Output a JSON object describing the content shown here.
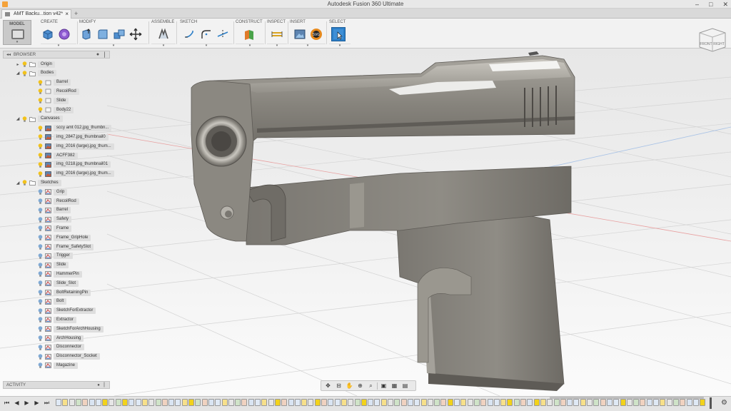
{
  "window": {
    "title": "Autodesk Fusion 360 Ultimate"
  },
  "tab": {
    "label": "AMT Backu...tion v42*"
  },
  "workspace": {
    "label": "MODEL"
  },
  "toolbar_groups": [
    {
      "label": "CREATE"
    },
    {
      "label": "MODIFY"
    },
    {
      "label": "ASSEMBLE"
    },
    {
      "label": "SKETCH"
    },
    {
      "label": "CONSTRUCT"
    },
    {
      "label": "INSPECT"
    },
    {
      "label": "INSERT"
    },
    {
      "label": "SELECT"
    }
  ],
  "viewcube": {
    "front": "FRONT",
    "right": "RIGHT"
  },
  "browser": {
    "title": "BROWSER",
    "items": [
      {
        "label": "Origin",
        "level": 1,
        "twisty": "▸",
        "kind": "folder"
      },
      {
        "label": "Bodies",
        "level": 1,
        "twisty": "◢",
        "kind": "folder"
      },
      {
        "label": "Barrel",
        "level": 2,
        "twisty": "",
        "kind": "body"
      },
      {
        "label": "RecoilRod",
        "level": 2,
        "twisty": "",
        "kind": "body"
      },
      {
        "label": "Slide",
        "level": 2,
        "twisty": "",
        "kind": "body"
      },
      {
        "label": "Body22",
        "level": 2,
        "twisty": "",
        "kind": "body"
      },
      {
        "label": "Canvases",
        "level": 1,
        "twisty": "◢",
        "kind": "folder"
      },
      {
        "label": "sccy amt 012.jpg_thumbn...",
        "level": 2,
        "twisty": "",
        "kind": "canvas"
      },
      {
        "label": "img_2847.jpg_thumbnail0",
        "level": 2,
        "twisty": "",
        "kind": "canvas"
      },
      {
        "label": "img_2016 (large).jpg_thum...",
        "level": 2,
        "twisty": "",
        "kind": "canvas"
      },
      {
        "label": "ACFF382",
        "level": 2,
        "twisty": "",
        "kind": "canvas"
      },
      {
        "label": "img_0218.jpg_thumbnail01",
        "level": 2,
        "twisty": "",
        "kind": "canvas"
      },
      {
        "label": "img_2016 (large).jpg_thum...",
        "level": 2,
        "twisty": "",
        "kind": "canvas"
      },
      {
        "label": "Sketches",
        "level": 1,
        "twisty": "◢",
        "kind": "folder"
      },
      {
        "label": "Grip",
        "level": 2,
        "twisty": "",
        "kind": "sketch"
      },
      {
        "label": "RecoilRod",
        "level": 2,
        "twisty": "",
        "kind": "sketch"
      },
      {
        "label": "Barrel",
        "level": 2,
        "twisty": "",
        "kind": "sketch"
      },
      {
        "label": "Safety",
        "level": 2,
        "twisty": "",
        "kind": "sketch"
      },
      {
        "label": "Frame",
        "level": 2,
        "twisty": "",
        "kind": "sketch"
      },
      {
        "label": "Frame_GripHole",
        "level": 2,
        "twisty": "",
        "kind": "sketch"
      },
      {
        "label": "Frame_SafetySlot",
        "level": 2,
        "twisty": "",
        "kind": "sketch"
      },
      {
        "label": "Trigger",
        "level": 2,
        "twisty": "",
        "kind": "sketch"
      },
      {
        "label": "Slide",
        "level": 2,
        "twisty": "",
        "kind": "sketch"
      },
      {
        "label": "HammerPin",
        "level": 2,
        "twisty": "",
        "kind": "sketch"
      },
      {
        "label": "Slide_Slot",
        "level": 2,
        "twisty": "",
        "kind": "sketch"
      },
      {
        "label": "BoltRetainingPin",
        "level": 2,
        "twisty": "",
        "kind": "sketch"
      },
      {
        "label": "Bolt",
        "level": 2,
        "twisty": "",
        "kind": "sketch"
      },
      {
        "label": "SketchForExtractor",
        "level": 2,
        "twisty": "",
        "kind": "sketch"
      },
      {
        "label": "Extractor",
        "level": 2,
        "twisty": "",
        "kind": "sketch"
      },
      {
        "label": "SketchForArchHousing",
        "level": 2,
        "twisty": "",
        "kind": "sketch"
      },
      {
        "label": "ArchHousing",
        "level": 2,
        "twisty": "",
        "kind": "sketch"
      },
      {
        "label": "Disconnector",
        "level": 2,
        "twisty": "",
        "kind": "sketch"
      },
      {
        "label": "Disconnector_Socket",
        "level": 2,
        "twisty": "",
        "kind": "sketch"
      },
      {
        "label": "Magazine",
        "level": 2,
        "twisty": "",
        "kind": "sketch"
      }
    ]
  },
  "activity": {
    "title": "ACTIVITY"
  },
  "colors": {
    "accent_blue": "#2c7fc8",
    "bulb_yellow": "#f2c21b",
    "bulb_blue": "#7fa9d4",
    "viewport_bg_top": "#e9e9e9",
    "viewport_bg_bottom": "#ffffff",
    "model_metal": "#8a8780"
  }
}
